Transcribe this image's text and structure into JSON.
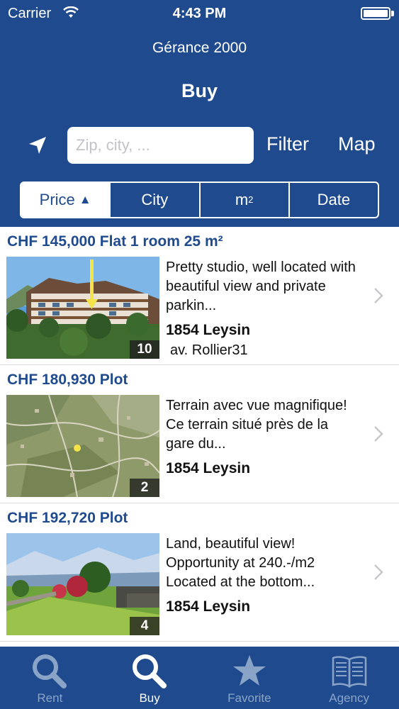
{
  "status": {
    "carrier": "Carrier",
    "time": "4:43 PM"
  },
  "header": {
    "agency": "Gérance 2000",
    "title": "Buy"
  },
  "search": {
    "placeholder": "Zip, city, ...",
    "filter_label": "Filter",
    "map_label": "Map"
  },
  "sort": {
    "price": "Price",
    "price_arrow": "▲",
    "city": "City",
    "area": "m",
    "area_sup": "2",
    "date": "Date",
    "active": "price"
  },
  "listings": [
    {
      "title": "CHF 145,000 Flat 1 room 25 m²",
      "description": "Pretty studio, well located with beautiful view and private parkin...",
      "city": "1854 Leysin",
      "street": "av. Rollier31",
      "photo_count": "10"
    },
    {
      "title": "CHF 180,930 Plot",
      "description": "Terrain avec vue magnifique! Ce terrain situé près de la gare du...",
      "city": "1854 Leysin",
      "photo_count": "2"
    },
    {
      "title": "CHF 192,720 Plot",
      "description": "Land, beautiful view! Opportunity at 240.-/m2 Located at the bottom...",
      "city": "1854 Leysin",
      "photo_count": "4"
    }
  ],
  "tabs": [
    {
      "label": "Rent",
      "icon": "search-icon"
    },
    {
      "label": "Buy",
      "icon": "search-icon",
      "active": true
    },
    {
      "label": "Favorite",
      "icon": "star-icon"
    },
    {
      "label": "Agency",
      "icon": "book-icon"
    }
  ],
  "colors": {
    "brand": "#1f4b8e",
    "inactive_tab": "#8aa4c8",
    "divider": "#d9d9de"
  }
}
